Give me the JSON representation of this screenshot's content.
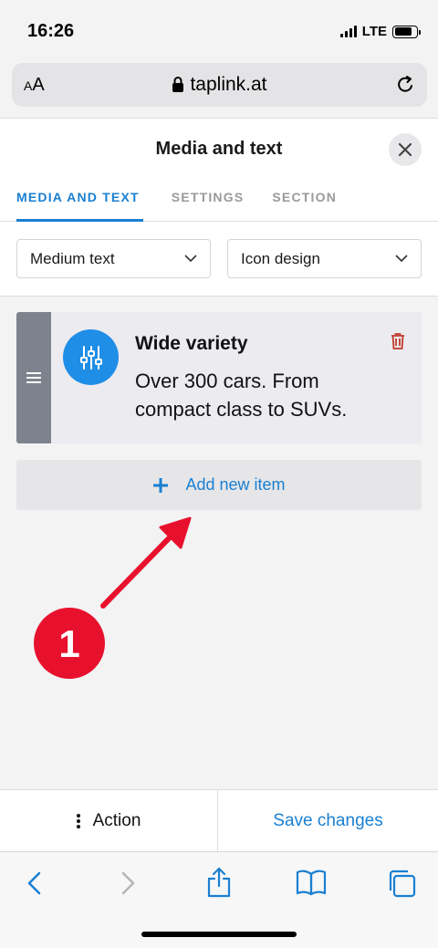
{
  "status_bar": {
    "time": "16:26",
    "network": "LTE"
  },
  "address_bar": {
    "text_size_label_small": "A",
    "text_size_label_big": "A",
    "url": "taplink.at"
  },
  "panel": {
    "title": "Media and text",
    "tabs": [
      {
        "label": "MEDIA AND TEXT",
        "active": true
      },
      {
        "label": "SETTINGS",
        "active": false
      },
      {
        "label": "SECTION",
        "active": false
      }
    ],
    "selects": [
      {
        "value": "Medium text"
      },
      {
        "value": "Icon design"
      }
    ],
    "item": {
      "title": "Wide variety",
      "text": "Over 300 cars. From compact class to SUVs.",
      "icon": "sliders-icon"
    },
    "add_button": {
      "label": "Add new item"
    }
  },
  "annotation": {
    "number": "1",
    "color": "#e8112d"
  },
  "action_bar": {
    "action_label": "Action",
    "save_label": "Save changes"
  },
  "colors": {
    "accent": "#1a7fd1",
    "icon_bg": "#1f8ee6",
    "trash": "#c0392b",
    "handle": "#7d838c"
  }
}
